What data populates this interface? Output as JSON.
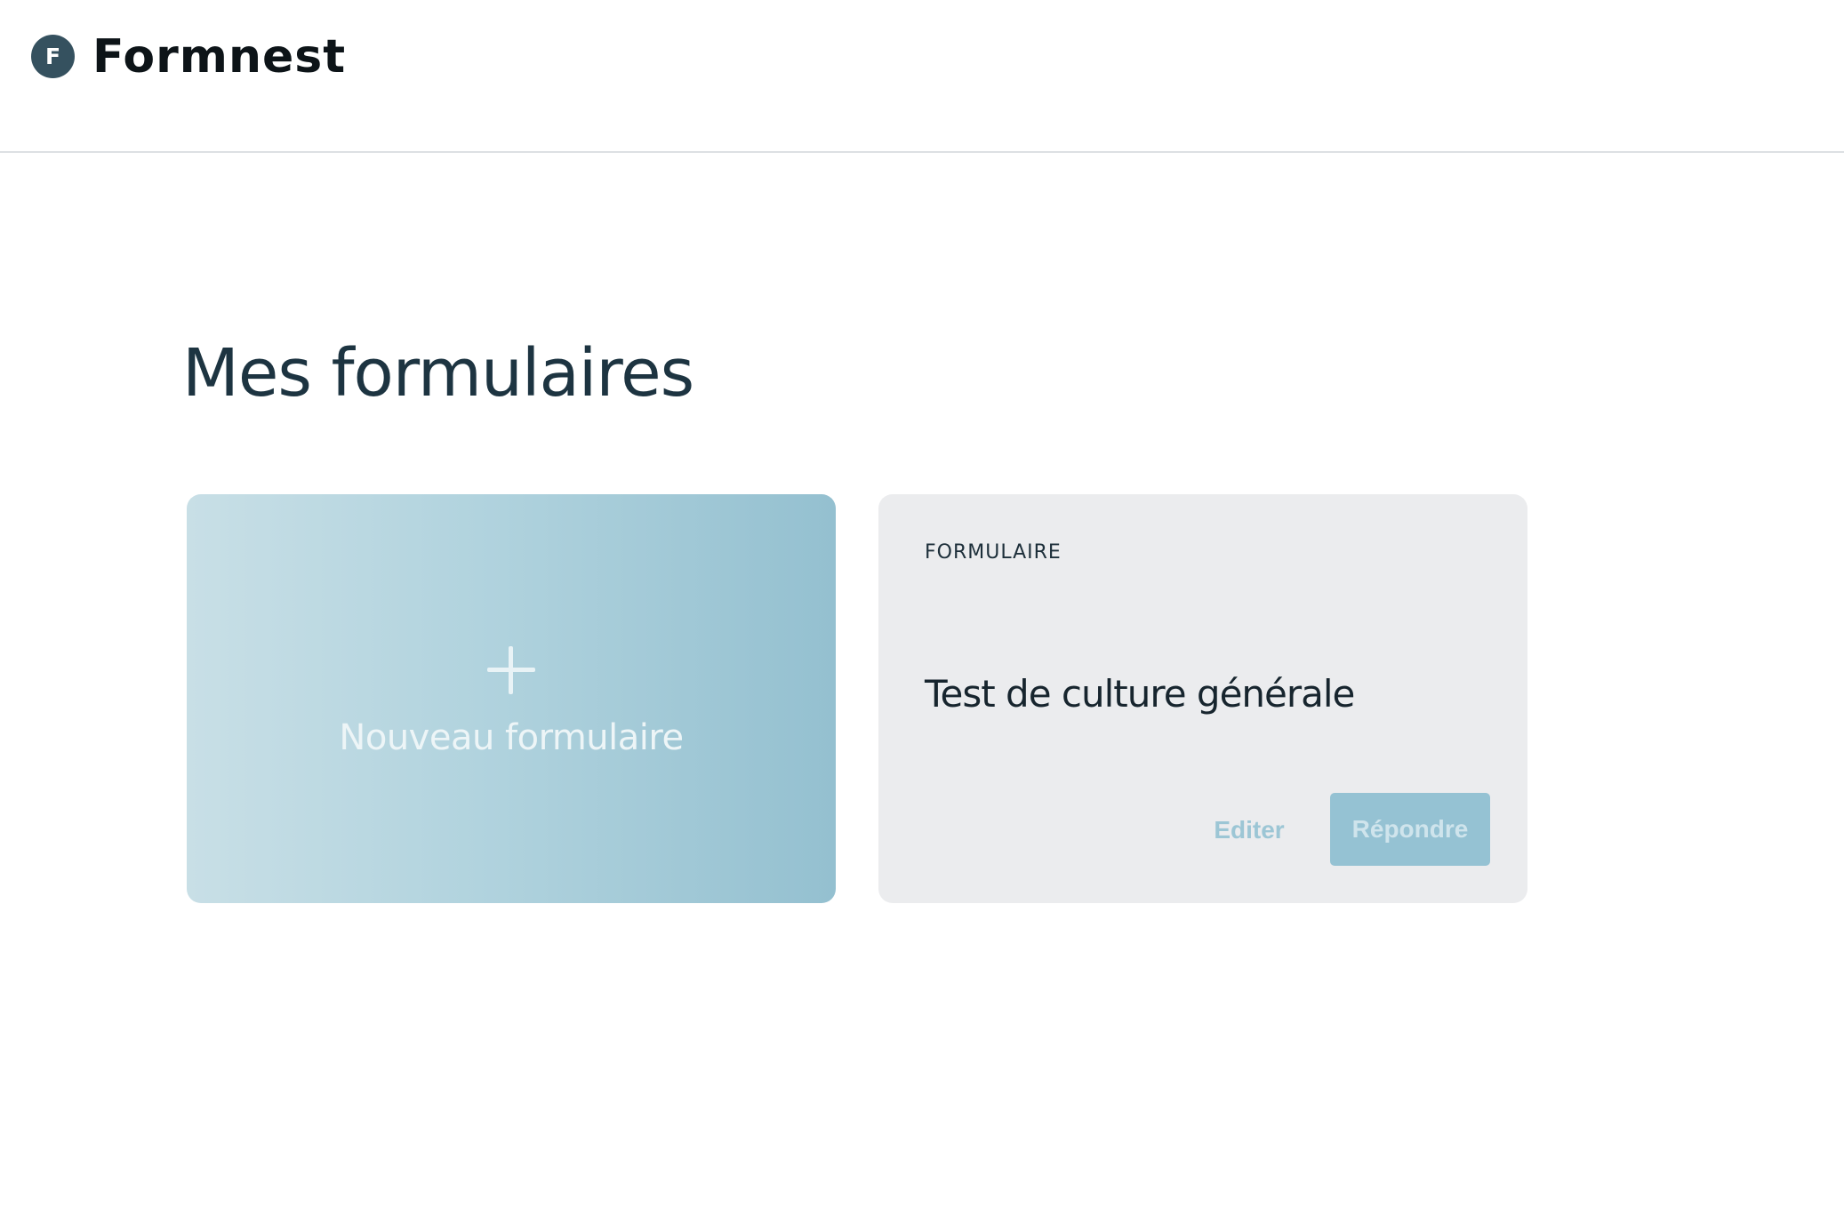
{
  "header": {
    "logo_letter": "F",
    "brand_name": "Formnest"
  },
  "main": {
    "title": "Mes formulaires",
    "new_form_card": {
      "icon": "plus-icon",
      "label": "Nouveau formulaire"
    },
    "forms": [
      {
        "type_label": "FORMULAIRE",
        "title": "Test de culture générale",
        "edit_label": "Editer",
        "reply_label": "Répondre"
      }
    ]
  },
  "colors": {
    "brand_dark": "#35515f",
    "title_text": "#1d3441",
    "accent": "#95c2d3",
    "card_background": "#ebecee"
  }
}
